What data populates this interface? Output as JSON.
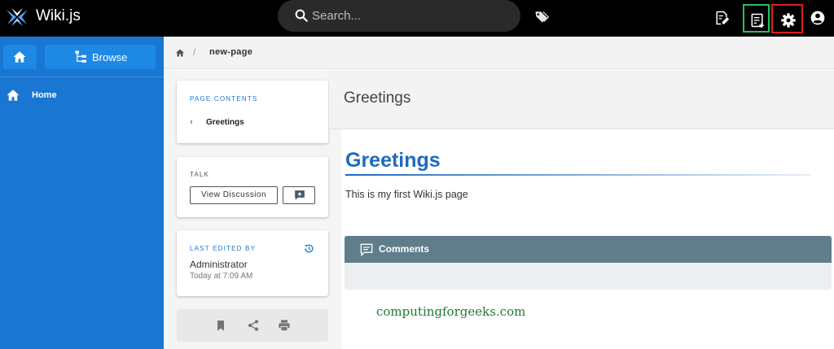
{
  "app": {
    "name": "Wiki.js"
  },
  "header": {
    "search_placeholder": "Search...",
    "colors": {
      "bar": "#000000",
      "newpage_highlight": "#22c55e",
      "settings_highlight": "#e11d1d"
    }
  },
  "sidebar": {
    "browse_label": "Browse",
    "items": [
      {
        "label": "Home",
        "icon": "home-icon"
      }
    ],
    "color": "#1976d2"
  },
  "breadcrumb": {
    "page": "new-page"
  },
  "page": {
    "title": "Greetings",
    "heading": "Greetings",
    "body": "This is my first Wiki.js page"
  },
  "toc": {
    "title": "PAGE CONTENTS",
    "items": [
      "Greetings"
    ]
  },
  "talk": {
    "title": "TALK",
    "view_label": "View Discussion"
  },
  "last_edited": {
    "title": "LAST EDITED BY",
    "name": "Administrator",
    "time": "Today at 7:09 AM"
  },
  "comments": {
    "label": "Comments"
  },
  "watermark": "computingforgeeks.com"
}
